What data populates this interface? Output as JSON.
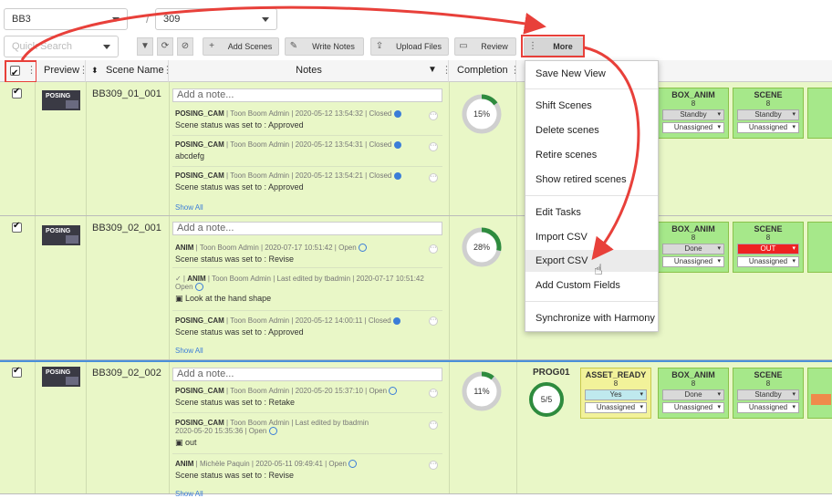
{
  "selectors": {
    "project": "BB3",
    "episode": "309",
    "search_placeholder": "Quick Search",
    "separator": "/"
  },
  "toolbar": {
    "filter_icon": "filter-icon",
    "refresh_icon": "refresh-icon",
    "clear_icon": "block-icon",
    "add_scenes": "Add Scenes",
    "write_notes": "Write Notes",
    "upload_files": "Upload Files",
    "review": "Review",
    "more": "More"
  },
  "columns": {
    "preview": "Preview",
    "scene_name": "Scene Name",
    "notes": "Notes",
    "completion": "Completion"
  },
  "note_placeholder": "Add a note...",
  "show_all": "Show All",
  "rows": [
    {
      "scene": "BB309_01_001",
      "thumb_label": "POSING",
      "completion": "15%",
      "completion_value": 15,
      "notes": [
        {
          "task": "POSING_CAM",
          "meta": "Toon Boom Admin  |  2020-05-12 13:54:32  |  Closed",
          "body": "Scene status was set to : Approved"
        },
        {
          "task": "POSING_CAM",
          "meta": "Toon Boom Admin  |  2020-05-12 13:54:31  |  Closed",
          "body": "abcdefg"
        },
        {
          "task": "POSING_CAM",
          "meta": "Toon Boom Admin  |  2020-05-12 13:54:21  |  Closed",
          "body": "Scene status was set to : Approved"
        }
      ],
      "tasks": [
        {
          "name": "BOX_ANIM",
          "num": "8",
          "status": "Standby",
          "assignee": "Unassigned"
        },
        {
          "name": "SCENE",
          "num": "8",
          "status": "Standby",
          "assignee": "Unassigned"
        }
      ]
    },
    {
      "scene": "BB309_02_001",
      "thumb_label": "POSING",
      "completion": "28%",
      "completion_value": 28,
      "notes": [
        {
          "task": "ANIM",
          "meta": "Toon Boom Admin  |  2020-07-17 10:51:42  |  Open",
          "body": "Scene status was set to : Revise"
        },
        {
          "task": "ANIM",
          "meta": "Toon Boom Admin  |  Last edited by tbadmin  |  2020-07-17 10:51:42",
          "meta2": "Open",
          "body": "Look at the hand shape"
        },
        {
          "task": "POSING_CAM",
          "meta": "Toon Boom Admin  |  2020-05-12 14:00:11  |  Closed",
          "body": "Scene status was set to : Approved"
        }
      ],
      "tasks": [
        {
          "name": "BOX_ANIM",
          "num": "8",
          "status": "Done",
          "assignee": "Unassigned"
        },
        {
          "name": "SCENE",
          "num": "8",
          "status": "OUT",
          "assignee": "Unassigned"
        }
      ]
    },
    {
      "scene": "BB309_02_002",
      "thumb_label": "POSING",
      "completion": "11%",
      "completion_value": 11,
      "notes": [
        {
          "task": "POSING_CAM",
          "meta": "Toon Boom Admin  |  2020-05-20 15:37:10  |  Open",
          "body": "Scene status was set to : Retake"
        },
        {
          "task": "POSING_CAM",
          "meta": "Toon Boom Admin  |  Last edited by tbadmin",
          "meta2": "2020-05-20 15:35:36  |  Open",
          "body": "out"
        },
        {
          "task": "ANIM",
          "meta": "Michèle Paquin  |  2020-05-11 09:49:41  |  Open",
          "body": "Scene status was set to : Revise"
        }
      ],
      "group": {
        "name": "PROG01",
        "count": "5/5"
      },
      "tasks": [
        {
          "name": "ASSET_READY",
          "num": "8",
          "status": "Yes",
          "assignee": "Unassigned"
        },
        {
          "name": "BOX_ANIM",
          "num": "8",
          "status": "Done",
          "assignee": "Unassigned"
        },
        {
          "name": "SCENE",
          "num": "8",
          "status": "Standby",
          "assignee": "Unassigned"
        }
      ]
    }
  ],
  "more_menu": [
    "Save New View",
    "Shift Scenes",
    "Delete scenes",
    "Retire scenes",
    "Show retired scenes",
    "Edit Tasks",
    "Import CSV",
    "Export CSV",
    "Add Custom Fields",
    "Synchronize with Harmony"
  ],
  "colors": {
    "row_bg": "#e9f7c7",
    "card_green": "#a6e88a",
    "card_yellow": "#f2f29a",
    "status_red": "#ee2222",
    "status_cyan": "#bfe9ee",
    "annotation_red": "#e8403a",
    "link_blue": "#3b7dd8"
  }
}
